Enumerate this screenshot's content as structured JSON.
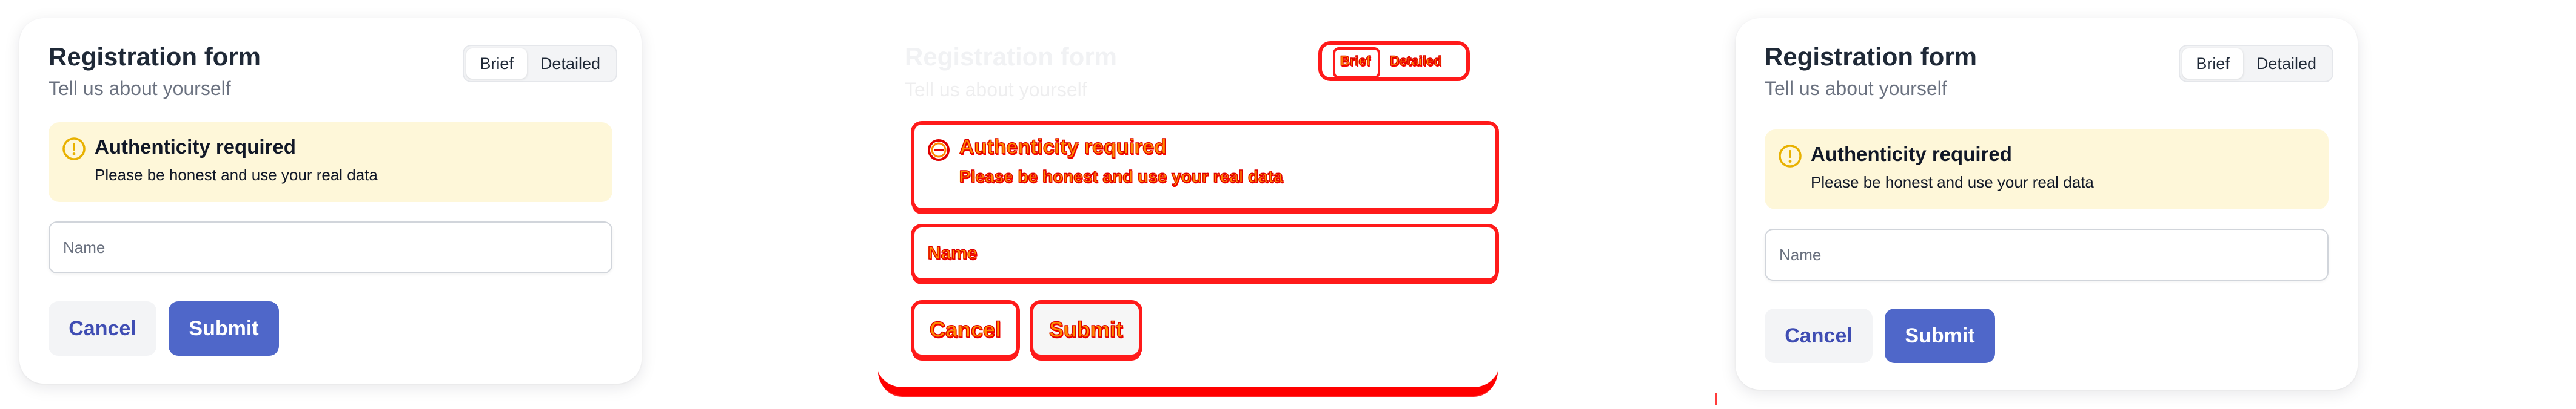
{
  "form": {
    "title": "Registration form",
    "subtitle": "Tell us about yourself",
    "toggle": {
      "options": [
        "Brief",
        "Detailed"
      ],
      "selected": "Brief"
    },
    "alert": {
      "title": "Authenticity required",
      "text": "Please be honest and use your real data",
      "icon": "exclamation-circle-icon"
    },
    "name_field": {
      "placeholder": "Name",
      "value": ""
    },
    "buttons": {
      "cancel": "Cancel",
      "submit": "Submit"
    }
  },
  "colors": {
    "alert_background": "#fef7d9",
    "alert_icon": "#e8b100",
    "submit_background": "#4f67c9",
    "cancel_text": "#3f4db3",
    "glitch_outline": "#ff1a1a",
    "glitch_fill": "#ff8a00"
  }
}
